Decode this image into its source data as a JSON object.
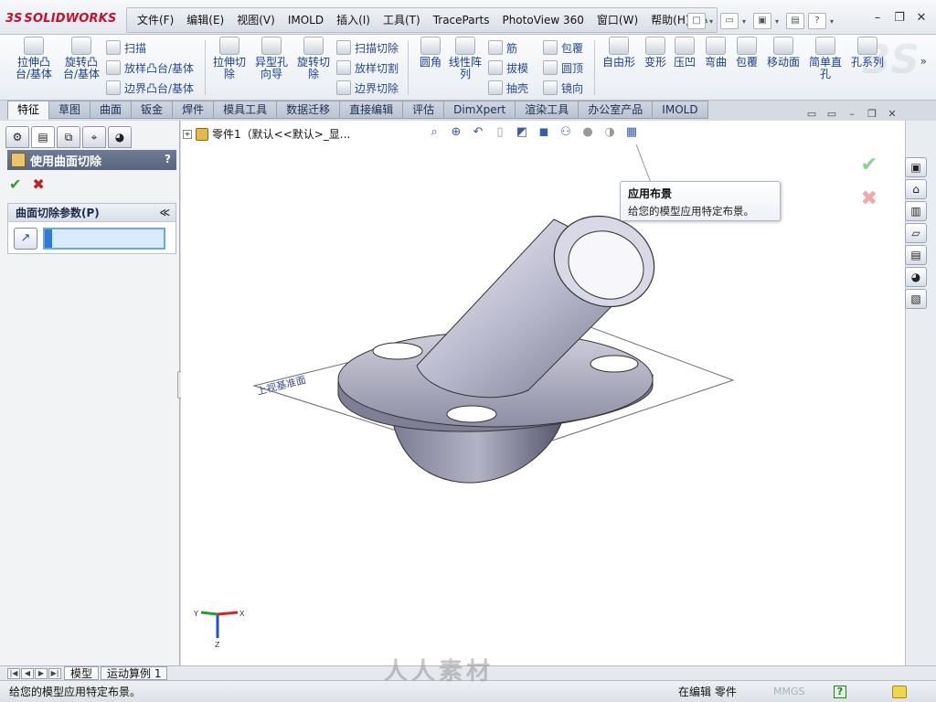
{
  "app": {
    "logo_prefix": "3S",
    "logo_text": "SOLIDWORKS"
  },
  "menu": [
    "文件(F)",
    "编辑(E)",
    "视图(V)",
    "IMOLD",
    "插入(I)",
    "工具(T)",
    "TraceParts",
    "PhotoView 360",
    "窗口(W)",
    "帮助(H)"
  ],
  "commands": {
    "extrude_boss": "拉伸凸台/基体",
    "revolve_boss": "旋转凸台/基体",
    "sweep": "扫描",
    "loft_boss": "放样凸台/基体",
    "boundary_boss": "边界凸台/基体",
    "extrude_cut": "拉伸切除",
    "hole_wizard": "异型孔向导",
    "revolve_cut": "旋转切除",
    "sweep_cut": "扫描切除",
    "loft_cut": "放样切割",
    "boundary_cut": "边界切除",
    "fillet": "圆角",
    "linear_pattern": "线性阵列",
    "rib": "筋",
    "draft": "拔模",
    "shell": "抽壳",
    "wrap": "包覆",
    "dome": "圆顶",
    "mirror": "镜向",
    "freeform": "自由形",
    "deform": "变形",
    "indent": "压凹",
    "flex": "弯曲",
    "wrap2": "包覆",
    "move_face": "移动面",
    "simple_hole": "简单直孔",
    "hole_series": "孔系列"
  },
  "tabs": [
    "特征",
    "草图",
    "曲面",
    "钣金",
    "焊件",
    "模具工具",
    "数据迁移",
    "直接编辑",
    "评估",
    "DimXpert",
    "渲染工具",
    "办公室产品",
    "IMOLD"
  ],
  "property_manager": {
    "title": "使用曲面切除",
    "help": "?",
    "group_title": "曲面切除参数(P)",
    "collapse": "≪"
  },
  "tree": {
    "label": "零件1（默认<<默认>_显..."
  },
  "tooltip": {
    "title": "应用布景",
    "desc": "给您的模型应用特定布景。"
  },
  "model": {
    "plane_label": "上视基准面"
  },
  "triad": {
    "x": "X",
    "y": "Y",
    "z": "Z"
  },
  "bottom_tabs": [
    "模型",
    "运动算例 1"
  ],
  "status": {
    "message": "给您的模型应用特定布景。",
    "editing": "在编辑 零件",
    "units": "MMGS",
    "help": "?"
  },
  "watermark": "人人素材"
}
